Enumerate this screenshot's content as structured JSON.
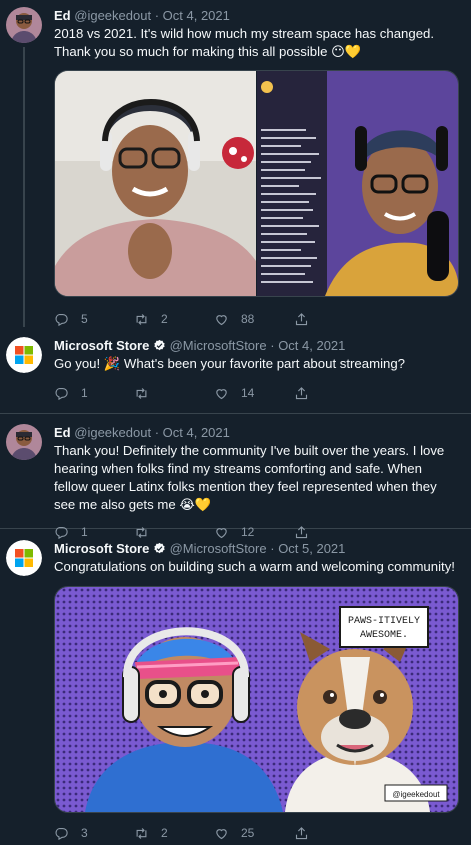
{
  "colors": {
    "background": "#15202b",
    "text": "#f5f8fa",
    "muted": "#8b98a5",
    "divider": "#38444d",
    "verified": "#1d9bf0"
  },
  "tweets": [
    {
      "name": "Ed",
      "handle": "@igeekedout",
      "sep": "·",
      "date": "Oct 4, 2021",
      "text": "2018 vs 2021. It's wild how much my stream space has changed. Thank you so much for making this all possible 😶💛",
      "stats": {
        "replies": "5",
        "retweets": "2",
        "likes": "88"
      }
    },
    {
      "name": "Microsoft Store",
      "handle": "@MicrosoftStore",
      "sep": "·",
      "date": "Oct 4, 2021",
      "text": "Go you! 🎉 What's been your favorite part about streaming?",
      "stats": {
        "replies": "1",
        "retweets": "",
        "likes": "14"
      }
    },
    {
      "name": "Ed",
      "handle": "@igeekedout",
      "sep": "·",
      "date": "Oct 4, 2021",
      "text": "Thank you! Definitely the community I've built over the years. I love hearing when folks find my streams comforting and safe. When fellow queer Latinx folks mention they feel represented when they see me also gets me 😭💛",
      "stats": {
        "replies": "1",
        "retweets": "",
        "likes": "12"
      }
    },
    {
      "name": "Microsoft Store",
      "handle": "@MicrosoftStore",
      "sep": "·",
      "date": "Oct 5, 2021",
      "text": "Congratulations on building such a warm and welcoming community!",
      "stats": {
        "replies": "3",
        "retweets": "2",
        "likes": "25"
      }
    }
  ],
  "illustration": {
    "speech": "PAWS-ITIVELY AWESOME.",
    "signature": "@igeekedout"
  },
  "icons": [
    "reply-icon",
    "retweet-icon",
    "like-icon",
    "share-icon",
    "verified-icon",
    "microsoft-logo"
  ]
}
